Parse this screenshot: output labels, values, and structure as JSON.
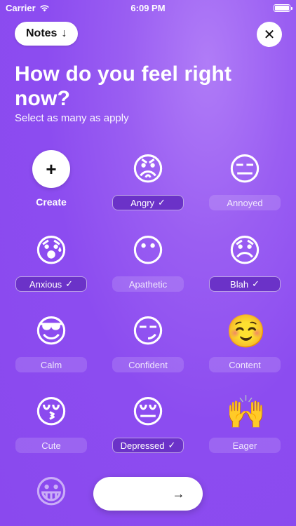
{
  "status": {
    "carrier": "Carrier",
    "time": "6:09 PM"
  },
  "header": {
    "notes_label": "Notes",
    "notes_icon": "↓",
    "close_icon": "✕",
    "title": "How do you feel right now?",
    "subtitle": "Select as many as apply"
  },
  "create": {
    "icon": "+",
    "label": "Create"
  },
  "check": "✓",
  "feelings": [
    {
      "emoji": "😡",
      "label": "Angry",
      "selected": true
    },
    {
      "emoji": "😑",
      "label": "Annoyed",
      "selected": false
    },
    {
      "emoji": "😰",
      "label": "Anxious",
      "selected": true
    },
    {
      "emoji": "😶",
      "label": "Apathetic",
      "selected": false
    },
    {
      "emoji": "😞",
      "label": "Blah",
      "selected": true
    },
    {
      "emoji": "😎",
      "label": "Calm",
      "selected": false
    },
    {
      "emoji": "😏",
      "label": "Confident",
      "selected": false
    },
    {
      "emoji": "☺️",
      "label": "Content",
      "selected": false
    },
    {
      "emoji": "😚",
      "label": "Cute",
      "selected": false
    },
    {
      "emoji": "😔",
      "label": "Depressed",
      "selected": true
    },
    {
      "emoji": "🙌",
      "label": "Eager",
      "selected": false
    },
    {
      "emoji": "😀",
      "label": "",
      "selected": false
    },
    {
      "emoji": "😁",
      "label": "",
      "selected": false
    }
  ],
  "bottom_bar": {
    "selected_emojis": [
      "😡",
      "😔",
      "😞",
      "😰"
    ],
    "arrow": "→"
  }
}
